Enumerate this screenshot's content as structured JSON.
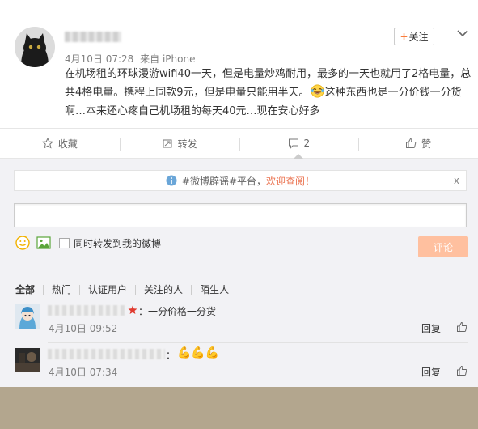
{
  "post": {
    "username": "",
    "meta": {
      "date": "4月10日 07:28",
      "source": "来自 iPhone"
    },
    "text_part1": "在机场租的环球漫游wifi40一天，但是电量炒鸡耐用，最多的一天也就用了2格电量，总共4格电量。携程上同款9元，但是电量只能用半天。",
    "text_part2": "这种东西也是一分价钱一分货啊…本来还心疼自己机场租的每天40元…现在安心好多",
    "emoji": "laughing-tears-emoji",
    "follow_label": "关注"
  },
  "actions": [
    {
      "label": "收藏",
      "icon": "star-icon"
    },
    {
      "label": "转发",
      "icon": "repost-icon"
    },
    {
      "label": "2",
      "icon": "comment-icon"
    },
    {
      "label": "赞",
      "icon": "thumbs-up-icon"
    }
  ],
  "comment_box": {
    "notice_prefix": "#微博辟谣#平台，",
    "notice_link": "欢迎查阅！",
    "notice_close": "x",
    "input_value": "",
    "repost_label": "同时转发到我的微博",
    "submit_label": "评论"
  },
  "tabs": [
    "全部",
    "热门",
    "认证用户",
    "关注的人",
    "陌生人"
  ],
  "comments": [
    {
      "text": "：一分价格一分货",
      "time": "4月10日 09:52",
      "reply": "回复"
    },
    {
      "text": "：",
      "emojis": "💪💪💪",
      "time": "4月10日 07:34",
      "reply": "回复"
    }
  ],
  "colors": {
    "accent": "#eb7350",
    "submit_bg": "#ffc09f",
    "page_bg": "#b3a68e",
    "comment_area_bg": "#f2f2f5"
  }
}
